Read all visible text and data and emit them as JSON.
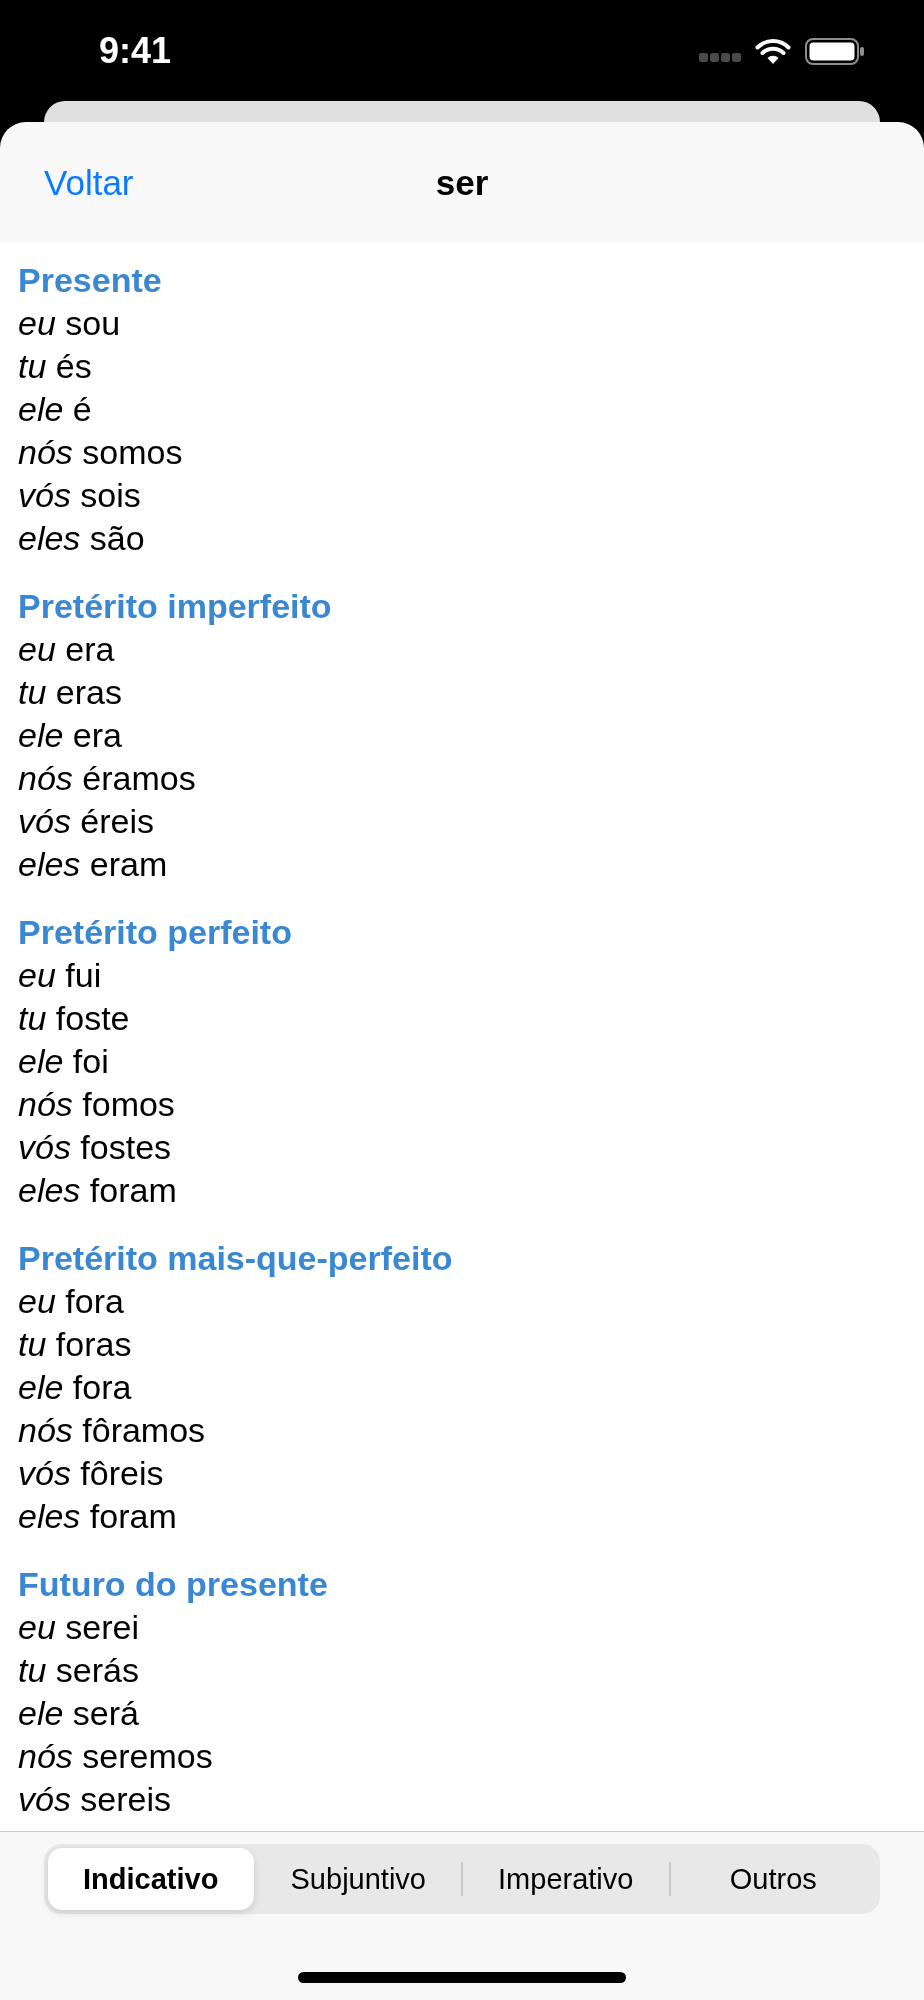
{
  "status_bar": {
    "time": "9:41"
  },
  "nav_bar": {
    "back": "Voltar",
    "title": "ser"
  },
  "sections": [
    {
      "heading": "Presente",
      "lines": [
        "*eu* sou",
        "*tu* és",
        "*ele* é",
        "*nós* somos",
        "*vós* sois",
        "*eles* são"
      ]
    },
    {
      "heading": "Pretérito imperfeito",
      "lines": [
        "*eu* era",
        "*tu* eras",
        "*ele* era",
        "*nós* éramos",
        "*vós* éreis",
        "*eles* eram"
      ]
    },
    {
      "heading": "Pretérito perfeito",
      "lines": [
        "*eu* fui",
        "*tu* foste",
        "*ele* foi",
        "*nós* fomos",
        "*vós* fostes",
        "*eles* foram"
      ]
    },
    {
      "heading": "Pretérito mais-que-perfeito",
      "lines": [
        "*eu* fora",
        "*tu* foras",
        "*ele* fora",
        "*nós* fôramos",
        "*vós* fôreis",
        "*eles* foram"
      ]
    },
    {
      "heading": "Futuro do presente",
      "lines": [
        "*eu* serei",
        "*tu* serás",
        "*ele* será",
        "*nós* seremos",
        "*vós* sereis"
      ]
    }
  ],
  "tabs": [
    {
      "label": "Indicativo",
      "selected": true
    },
    {
      "label": "Subjuntivo",
      "selected": false
    },
    {
      "label": "Imperativo",
      "selected": false
    },
    {
      "label": "Outros",
      "selected": false
    }
  ]
}
